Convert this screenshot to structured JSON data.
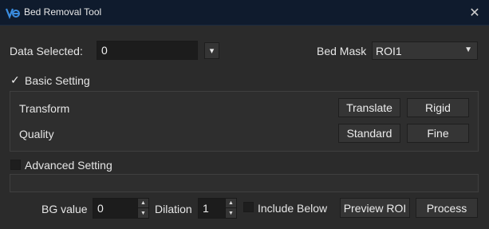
{
  "window": {
    "title": "Bed Removal Tool",
    "close_symbol": "✕"
  },
  "data_selected": {
    "label": "Data Selected:",
    "value": "0",
    "dropdown_arrow": "▾"
  },
  "bed_mask": {
    "label": "Bed Mask",
    "value": "ROI1",
    "dropdown_arrow": "▼"
  },
  "basic_setting": {
    "label": "Basic Setting",
    "checked": true,
    "check_symbol": "✓",
    "transform": {
      "label": "Transform",
      "buttons": [
        "Translate",
        "Rigid"
      ]
    },
    "quality": {
      "label": "Quality",
      "buttons": [
        "Standard",
        "Fine"
      ]
    }
  },
  "advanced_setting": {
    "label": "Advanced Setting",
    "checked": false
  },
  "bottom": {
    "bg_value": {
      "label": "BG value",
      "value": "0"
    },
    "dilation": {
      "label": "Dilation",
      "value": "1"
    },
    "include_below": {
      "label": "Include Below",
      "checked": false
    },
    "preview_roi_label": "Preview ROI",
    "process_label": "Process",
    "spin_up": "▲",
    "spin_down": "▼"
  },
  "colors": {
    "titlebar": "#0f1b2d",
    "background": "#2b2b2b",
    "field": "#1c1c1c",
    "button": "#353535",
    "icon_accent": "#3b8de0"
  }
}
